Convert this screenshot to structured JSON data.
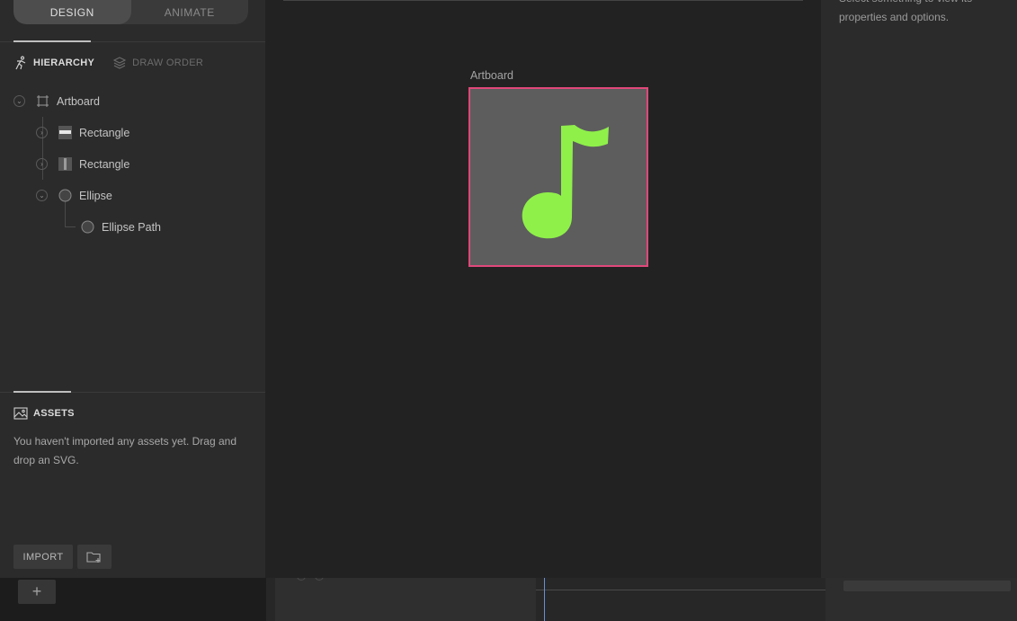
{
  "mode_toggle": {
    "design_label": "DESIGN",
    "animate_label": "ANIMATE",
    "active": "design"
  },
  "tabs": {
    "hierarchy_label": "HIERARCHY",
    "draw_order_label": "DRAW ORDER",
    "active": "hierarchy"
  },
  "hierarchy": [
    {
      "label": "Artboard",
      "icon": "artboard-icon",
      "expanded": true,
      "depth": 0
    },
    {
      "label": "Rectangle",
      "icon": "rectangle-horizontal-icon",
      "expanded": false,
      "depth": 1
    },
    {
      "label": "Rectangle",
      "icon": "rectangle-vertical-icon",
      "expanded": false,
      "depth": 1
    },
    {
      "label": "Ellipse",
      "icon": "ellipse-icon",
      "expanded": true,
      "depth": 1
    },
    {
      "label": "Ellipse Path",
      "icon": "ellipse-path-icon",
      "depth": 2
    }
  ],
  "assets": {
    "title": "ASSETS",
    "empty_message": "You haven't imported any assets yet. Drag and drop an SVG.",
    "import_label": "IMPORT"
  },
  "stage": {
    "artboard_label": "Artboard",
    "artboard_fill": "#5d5d5d",
    "selection_color": "#e0487a",
    "note_color": "#8ff04a",
    "artboard_content_icon": "music-note-icon"
  },
  "inspector": {
    "message": "Select something to view its properties and options."
  },
  "colors": {
    "panel_bg": "#2b2b2b",
    "stage_bg": "#222222",
    "accent_selection": "#e0487a",
    "shape_green": "#8ff04a"
  }
}
